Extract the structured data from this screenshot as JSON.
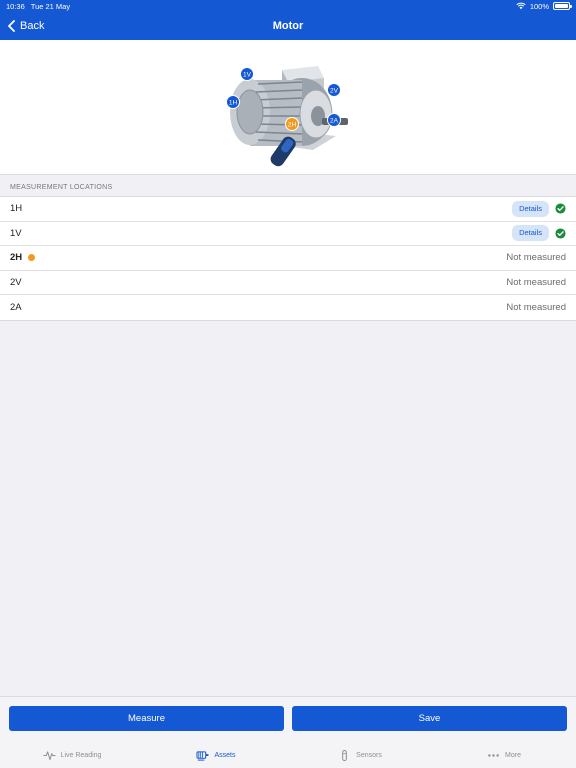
{
  "status": {
    "time": "10:36",
    "date": "Tue 21 May",
    "battery": "100%"
  },
  "nav": {
    "back_label": "Back",
    "title": "Motor"
  },
  "motor_labels": {
    "1V": "1V",
    "1H": "1H",
    "2V": "2V",
    "2H": "2H",
    "2A": "2A"
  },
  "section": {
    "header": "MEASUREMENT LOCATIONS"
  },
  "locations": [
    {
      "name": "1H",
      "details": "Details",
      "status": "measured"
    },
    {
      "name": "1V",
      "details": "Details",
      "status": "measured"
    },
    {
      "name": "2H",
      "status_text": "Not measured",
      "active": true
    },
    {
      "name": "2V",
      "status_text": "Not measured"
    },
    {
      "name": "2A",
      "status_text": "Not measured"
    }
  ],
  "actions": {
    "measure": "Measure",
    "save": "Save"
  },
  "tabs": [
    {
      "label": "Live Reading",
      "icon": "pulse-icon"
    },
    {
      "label": "Assets",
      "icon": "asset-icon",
      "active": true
    },
    {
      "label": "Sensors",
      "icon": "sensor-icon"
    },
    {
      "label": "More",
      "icon": "more-dots-icon"
    }
  ],
  "colors": {
    "primary": "#1458d4",
    "active_dot": "#f39a1e",
    "check": "#1a8a3c"
  }
}
